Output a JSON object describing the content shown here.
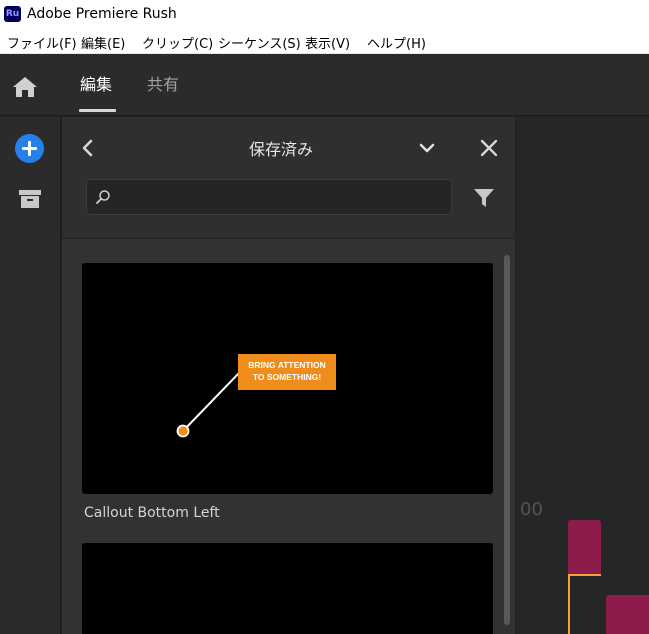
{
  "window": {
    "app_icon_text": "Ru",
    "title": "Adobe Premiere Rush"
  },
  "menu": {
    "items": [
      "ファイル(F)",
      "編集(E)",
      "クリップ(C)",
      "シーケンス(S)",
      "表示(V)",
      "ヘルプ(H)"
    ]
  },
  "header": {
    "home_icon": "home-icon",
    "tabs": [
      {
        "label": "編集",
        "active": true
      },
      {
        "label": "共有",
        "active": false
      }
    ]
  },
  "rail": {
    "add_icon": "plus-circle-icon",
    "archive_icon": "archive-icon",
    "accent_color": "#2680eb"
  },
  "panel": {
    "title": "保存済み",
    "search": {
      "placeholder": "",
      "value": ""
    },
    "items": [
      {
        "name": "Callout Bottom Left",
        "preview_text": [
          "BRING ATTENTION",
          "TO SOMETHING!"
        ],
        "preview_accent": "#f08c1c"
      },
      {
        "name": "",
        "preview_text": []
      }
    ]
  },
  "timeline": {
    "time_label": "00",
    "clip_color": "#8c1b4c",
    "playhead_color": "#f2a33a"
  }
}
